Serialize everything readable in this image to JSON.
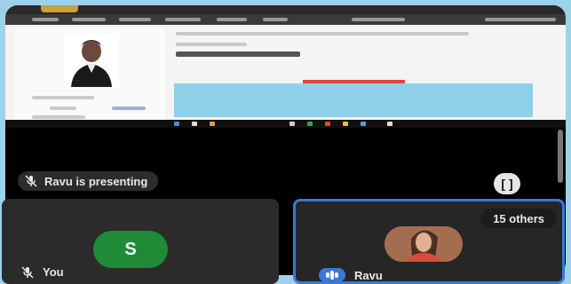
{
  "presentation": {
    "presenting_text": "Ravu is presenting",
    "mic_icon": "mic-off-icon",
    "fullscreen_icon": "fullscreen-icon",
    "fullscreen_glyph": "[ ]"
  },
  "participants": {
    "you": {
      "avatar_letter": "S",
      "name": "You",
      "avatar_color": "#1f8b36"
    },
    "ravu": {
      "name": "Ravu",
      "others_label": "15 others",
      "highlight_color": "#3a78d8"
    }
  },
  "colors": {
    "page_background": "#9ed2ea",
    "meet_background": "#000000",
    "tile_background": "#2b2b2b"
  }
}
